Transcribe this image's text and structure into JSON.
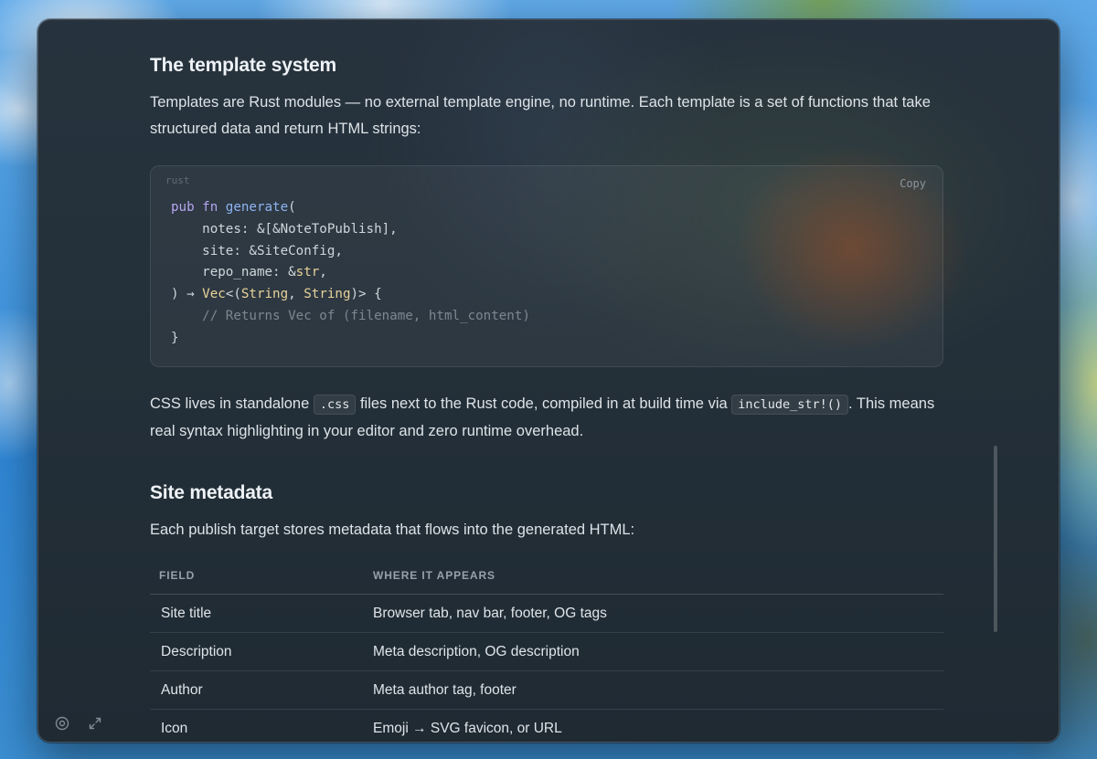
{
  "article": {
    "template_heading": "The template system",
    "template_paragraph": "Templates are Rust modules — no external template engine, no runtime. Each template is a set of functions that take structured data and return HTML strings:",
    "code_block": {
      "language": "rust",
      "copy_label": "Copy",
      "lines": [
        [
          {
            "t": "pub ",
            "c": "kw"
          },
          {
            "t": "fn ",
            "c": "kw"
          },
          {
            "t": "generate",
            "c": "fn"
          },
          {
            "t": "(",
            "c": "pl"
          }
        ],
        [
          {
            "t": "    notes: &[&NoteToPublish],",
            "c": "pl"
          }
        ],
        [
          {
            "t": "    site: &SiteConfig,",
            "c": "pl"
          }
        ],
        [
          {
            "t": "    repo_name: &",
            "c": "pl"
          },
          {
            "t": "str",
            "c": "type"
          },
          {
            "t": ",",
            "c": "pl"
          }
        ],
        [
          {
            "t": ") → ",
            "c": "pl"
          },
          {
            "t": "Vec",
            "c": "type"
          },
          {
            "t": "<(",
            "c": "pl"
          },
          {
            "t": "String",
            "c": "type"
          },
          {
            "t": ", ",
            "c": "pl"
          },
          {
            "t": "String",
            "c": "type"
          },
          {
            "t": ")> {",
            "c": "pl"
          }
        ],
        [
          {
            "t": "    // Returns Vec of (filename, html_content)",
            "c": "cm"
          }
        ],
        [
          {
            "t": "}",
            "c": "pl"
          }
        ]
      ]
    },
    "css_paragraph": {
      "part1": "CSS lives in standalone ",
      "code1": ".css",
      "part2": " files next to the Rust code, compiled in at build time via ",
      "code2": "include_str!()",
      "part3": ". This means real syntax highlighting in your editor and zero runtime overhead."
    },
    "site_heading": "Site metadata",
    "site_paragraph": "Each publish target stores metadata that flows into the generated HTML:",
    "table": {
      "headers": [
        "FIELD",
        "WHERE IT APPEARS"
      ],
      "rows": [
        [
          "Site title",
          "Browser tab, nav bar, footer, OG tags"
        ],
        [
          "Description",
          "Meta description, OG description"
        ],
        [
          "Author",
          "Meta author tag, footer"
        ],
        [
          "Icon",
          "Emoji → SVG favicon, or URL"
        ]
      ]
    }
  },
  "footer_icons": [
    "target-icon",
    "expand-icon"
  ],
  "colors": {
    "keyword": "#b7a6f0",
    "function": "#8fb4f2",
    "type": "#e8d39a",
    "comment": "#7c8791"
  }
}
